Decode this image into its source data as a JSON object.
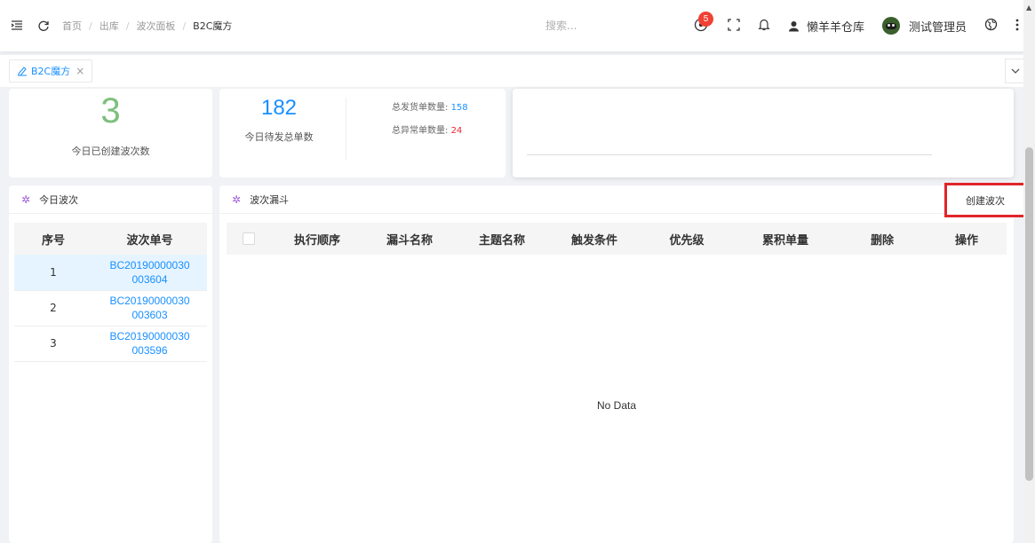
{
  "header": {
    "breadcrumbs": [
      "首页",
      "出库",
      "波次面板",
      "B2C魔方"
    ],
    "search_placeholder": "搜索...",
    "notification_count": "5",
    "warehouse": "懒羊羊仓库",
    "username": "测试管理员"
  },
  "tabs": {
    "items": [
      {
        "label": "B2C魔方",
        "close": "×"
      }
    ]
  },
  "stats": {
    "created_waves": "3",
    "created_waves_label": "今日已创建波次数",
    "pending_orders": "182",
    "pending_orders_label": "今日待发总单数",
    "shipped_label": "总发货单数量:",
    "shipped_value": "158",
    "exception_label": "总异常单数量:",
    "exception_value": "24"
  },
  "today_waves": {
    "title": "今日波次",
    "columns": [
      "序号",
      "波次单号"
    ],
    "rows": [
      {
        "index": "1",
        "line1": "BC20190000030",
        "line2": "003604"
      },
      {
        "index": "2",
        "line1": "BC20190000030",
        "line2": "003603"
      },
      {
        "index": "3",
        "line1": "BC20190000030",
        "line2": "003596"
      }
    ]
  },
  "funnel": {
    "title": "波次漏斗",
    "create_button": "创建波次",
    "columns": [
      "执行顺序",
      "漏斗名称",
      "主题名称",
      "触发条件",
      "优先级",
      "累积单量",
      "删除",
      "操作"
    ],
    "empty_text": "No Data"
  },
  "colors": {
    "accent": "#1890ff",
    "green_number": "#7dbf7d",
    "exception_red": "#f5222d",
    "highlight_border": "#e0252a"
  }
}
